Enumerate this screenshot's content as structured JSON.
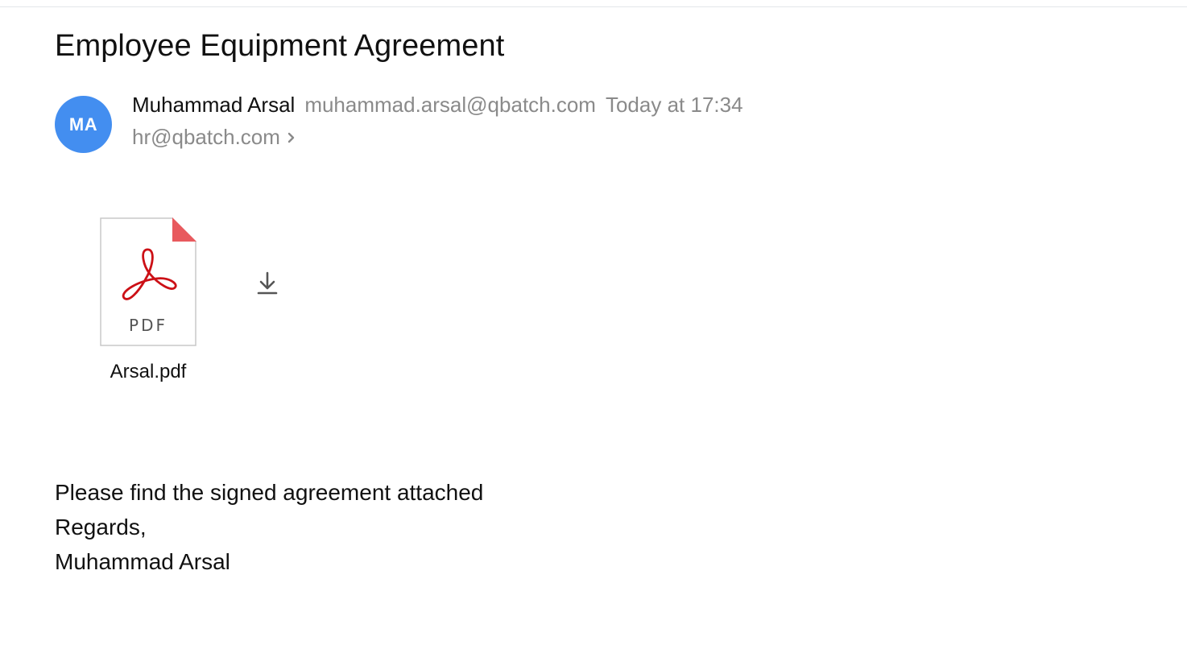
{
  "message": {
    "subject": "Employee Equipment Agreement",
    "sender": {
      "initials": "MA",
      "name": "Muhammad Arsal",
      "email": "muhammad.arsal@qbatch.com",
      "avatar_color": "#438ef0"
    },
    "time": "Today at 17:34",
    "recipient": "hr@qbatch.com",
    "attachments": [
      {
        "file_name": "Arsal.pdf",
        "type_label": "PDF",
        "icon": "pdf-file-icon",
        "download_icon": "download-icon"
      }
    ],
    "body_lines": [
      "Please find the signed agreement attached",
      "Regards,",
      "Muhammad Arsal"
    ]
  },
  "colors": {
    "pdf_red": "#cc1016",
    "corner_fold": "#e85a5e",
    "secondary_text": "#8a8a8a"
  }
}
